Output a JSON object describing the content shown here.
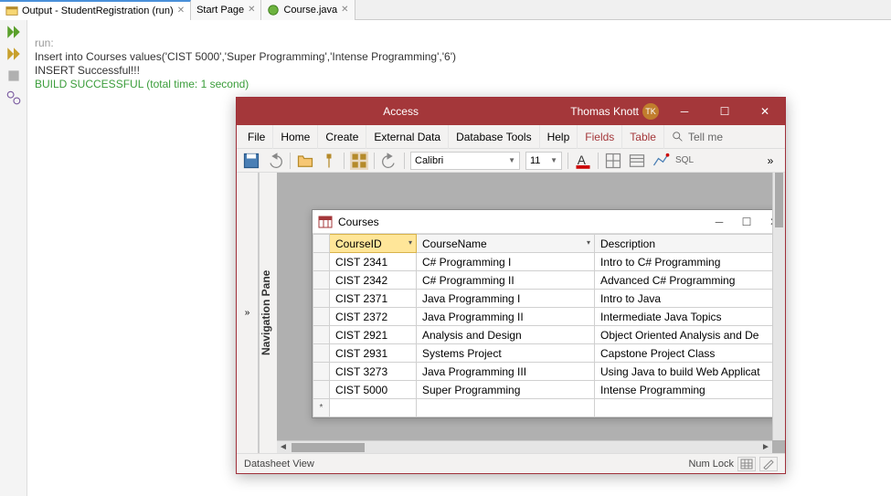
{
  "ide": {
    "tabs": [
      {
        "label": "Output - StudentRegistration (run)",
        "active": true,
        "icon": "output-icon"
      },
      {
        "label": "Start Page",
        "active": false,
        "icon": ""
      },
      {
        "label": "Course.java",
        "active": false,
        "icon": "java-icon"
      }
    ],
    "console": {
      "line1": "run:",
      "line2": "Insert into Courses values('CIST 5000','Super Programming','Intense Programming','6')",
      "line3": "INSERT Successful!!!",
      "line4": "BUILD SUCCESSFUL (total time: 1 second)"
    }
  },
  "access": {
    "title": "Access",
    "user": "Thomas Knott",
    "initials": "TK",
    "ribbon": {
      "file": "File",
      "home": "Home",
      "create": "Create",
      "external": "External Data",
      "dbtools": "Database Tools",
      "help": "Help",
      "fields": "Fields",
      "table": "Table",
      "tellme": "Tell me"
    },
    "toolbar": {
      "font": "Calibri",
      "size": "11",
      "sql_label": "SQL"
    },
    "nav_collapse": "»",
    "nav_label": "Navigation Pane",
    "status": {
      "view": "Datasheet View",
      "numlock": "Num Lock"
    }
  },
  "courses": {
    "title": "Courses",
    "columns": {
      "id": "CourseID",
      "name": "CourseName",
      "desc": "Description"
    },
    "rows": [
      {
        "id": "CIST 2341",
        "name": "C# Programming I",
        "desc": "Intro to C# Programming"
      },
      {
        "id": "CIST 2342",
        "name": "C# Programming II",
        "desc": "Advanced C# Programming"
      },
      {
        "id": "CIST 2371",
        "name": "Java Programming I",
        "desc": "Intro to Java"
      },
      {
        "id": "CIST 2372",
        "name": "Java Programming II",
        "desc": "Intermediate Java Topics"
      },
      {
        "id": "CIST 2921",
        "name": "Analysis and Design",
        "desc": "Object Oriented Analysis and De"
      },
      {
        "id": "CIST 2931",
        "name": "Systems Project",
        "desc": "Capstone Project Class"
      },
      {
        "id": "CIST 3273",
        "name": "Java Programming III",
        "desc": "Using Java to build Web Applicat"
      },
      {
        "id": "CIST 5000",
        "name": "Super Programming",
        "desc": "Intense Programming"
      }
    ],
    "new_row_marker": "*"
  }
}
